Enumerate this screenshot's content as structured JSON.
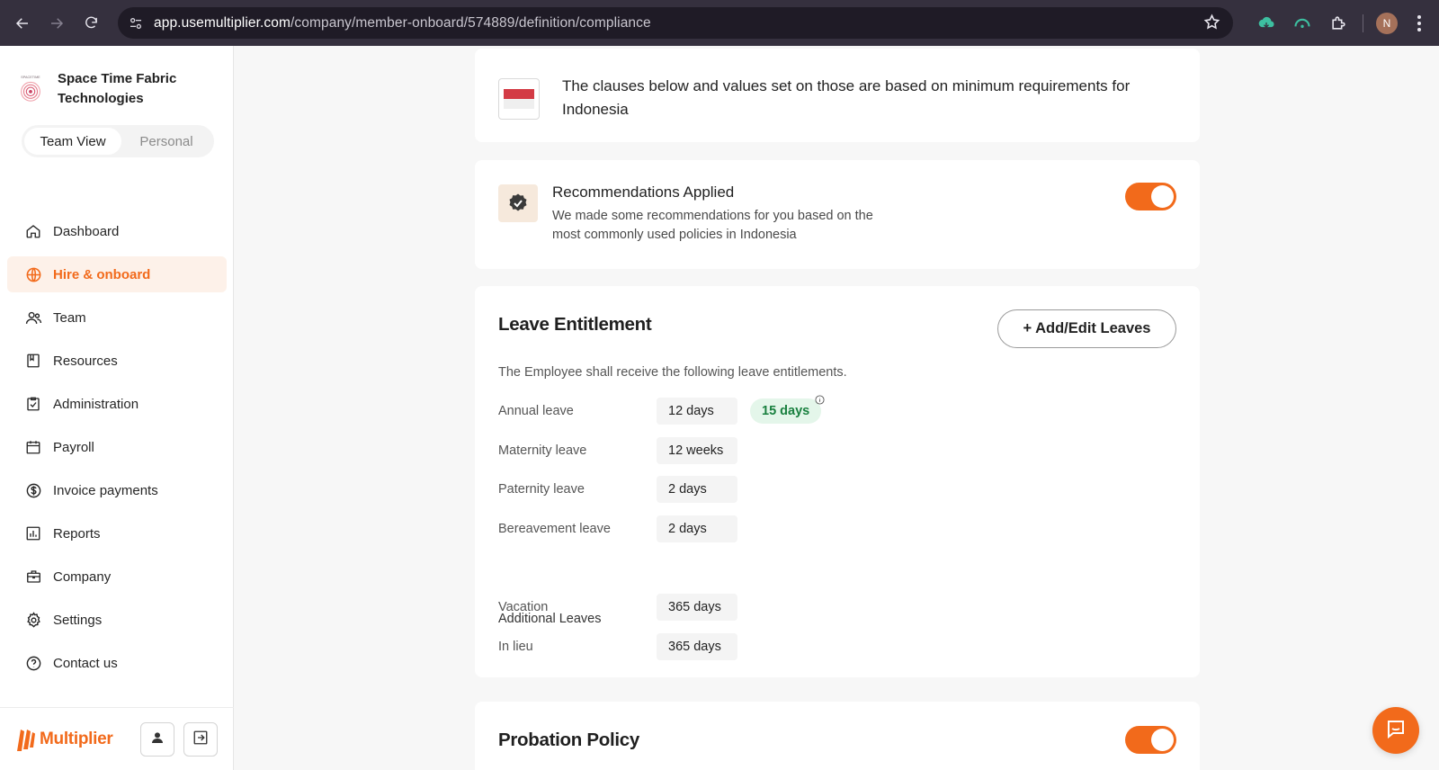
{
  "browser": {
    "url_host": "app.usemultiplier.com",
    "url_path": "/company/member-onboard/574889/definition/compliance",
    "profile_initial": "N"
  },
  "sidebar": {
    "company_name": "Space Time Fabric Technologies",
    "logo_text": "SPACETIME",
    "view_toggle": {
      "team": "Team View",
      "personal": "Personal"
    },
    "items": [
      {
        "label": "Dashboard",
        "icon": "home-icon"
      },
      {
        "label": "Hire & onboard",
        "icon": "globe-icon",
        "active": true
      },
      {
        "label": "Team",
        "icon": "people-icon"
      },
      {
        "label": "Resources",
        "icon": "resources-icon"
      },
      {
        "label": "Administration",
        "icon": "clipboard-check-icon"
      },
      {
        "label": "Payroll",
        "icon": "calendar-icon"
      },
      {
        "label": "Invoice payments",
        "icon": "dollar-icon"
      },
      {
        "label": "Reports",
        "icon": "bar-chart-icon"
      },
      {
        "label": "Company",
        "icon": "briefcase-icon"
      },
      {
        "label": "Settings",
        "icon": "gear-icon"
      },
      {
        "label": "Contact us",
        "icon": "help-icon"
      }
    ],
    "brand": "Multiplier"
  },
  "country_notice": {
    "text": "The clauses below and values set on those are based on minimum requirements for Indonesia"
  },
  "recommendations": {
    "title": "Recommendations Applied",
    "description": "We made some recommendations for you based on the most commonly used policies in Indonesia",
    "enabled": true
  },
  "leave_entitlement": {
    "title": "Leave Entitlement",
    "add_button": "+ Add/Edit Leaves",
    "intro": "The Employee shall receive the following leave entitlements.",
    "leaves": [
      {
        "label": "Annual leave",
        "value": "12 days",
        "recommended": "15 days"
      },
      {
        "label": "Maternity leave",
        "value": "12 weeks"
      },
      {
        "label": "Paternity leave",
        "value": "2 days"
      },
      {
        "label": "Bereavement leave",
        "value": "2 days"
      }
    ],
    "additional_heading": "Additional Leaves",
    "additional": [
      {
        "label": "Vacation",
        "value": "365 days"
      },
      {
        "label": "In lieu",
        "value": "365 days"
      }
    ]
  },
  "probation": {
    "title": "Probation Policy",
    "enabled": true
  },
  "colors": {
    "accent": "#f26a1b",
    "recommended_bg": "#e4f6ea",
    "recommended_text": "#19803f"
  }
}
